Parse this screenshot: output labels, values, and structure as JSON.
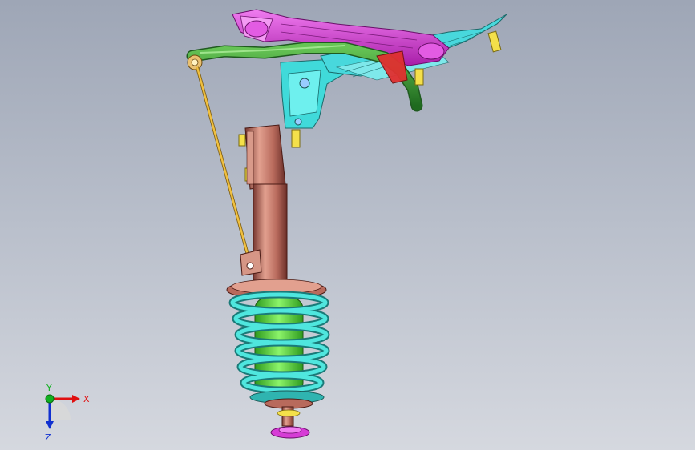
{
  "viewport": {
    "background_top": "#9ea6b6",
    "background_bottom": "#d5d8df"
  },
  "triad": {
    "x_label": "X",
    "y_label": "Y",
    "z_label": "Z",
    "x_color": "#e01010",
    "y_color": "#10b020",
    "z_color": "#1030d0"
  },
  "parts": {
    "control_arm_color": "#d63cd6",
    "subframe_color": "#40dada",
    "stabilizer_bar_color": "#2e8b2e",
    "link_color": "#f0c040",
    "strut_color": "#c06e62",
    "spring_color": "#2fd0c8",
    "bump_stop_color": "#66e24a",
    "bolt_color": "#f4e04a"
  }
}
